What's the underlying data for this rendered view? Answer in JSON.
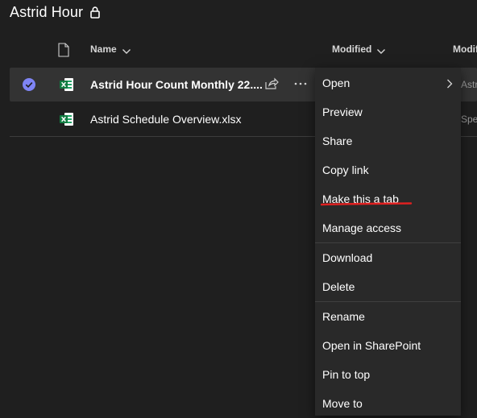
{
  "header": {
    "title": "Astrid Hour"
  },
  "columns": {
    "name": "Name",
    "modified": "Modified",
    "modified_by": "Modifi"
  },
  "files": [
    {
      "name": "Astrid Hour Count Monthly 22....",
      "selected": true,
      "peek": "Astric"
    },
    {
      "name": "Astrid Schedule Overview.xlsx",
      "selected": false,
      "peek": "Speak"
    }
  ],
  "menu": {
    "items": [
      {
        "label": "Open"
      },
      {
        "label": "Preview"
      },
      {
        "label": "Share"
      },
      {
        "label": "Copy link"
      },
      {
        "label": "Make this a tab"
      },
      {
        "label": "Manage access"
      },
      {
        "label": "Download"
      },
      {
        "label": "Delete"
      },
      {
        "label": "Rename"
      },
      {
        "label": "Open in SharePoint"
      },
      {
        "label": "Pin to top"
      },
      {
        "label": "Move to"
      }
    ]
  },
  "colors": {
    "background": "#1f1f1f",
    "selected_row": "#333333",
    "menu_bg": "#292929",
    "check_accent": "#7f85f5",
    "excel_green": "#21a366",
    "annotation_red": "#e02020"
  },
  "icons": {
    "lock": "lock-icon",
    "file_type": "file-type-icon",
    "excel": "excel-icon",
    "share": "share-icon",
    "more": "more-options-icon",
    "check": "checkmark-circle-icon"
  }
}
